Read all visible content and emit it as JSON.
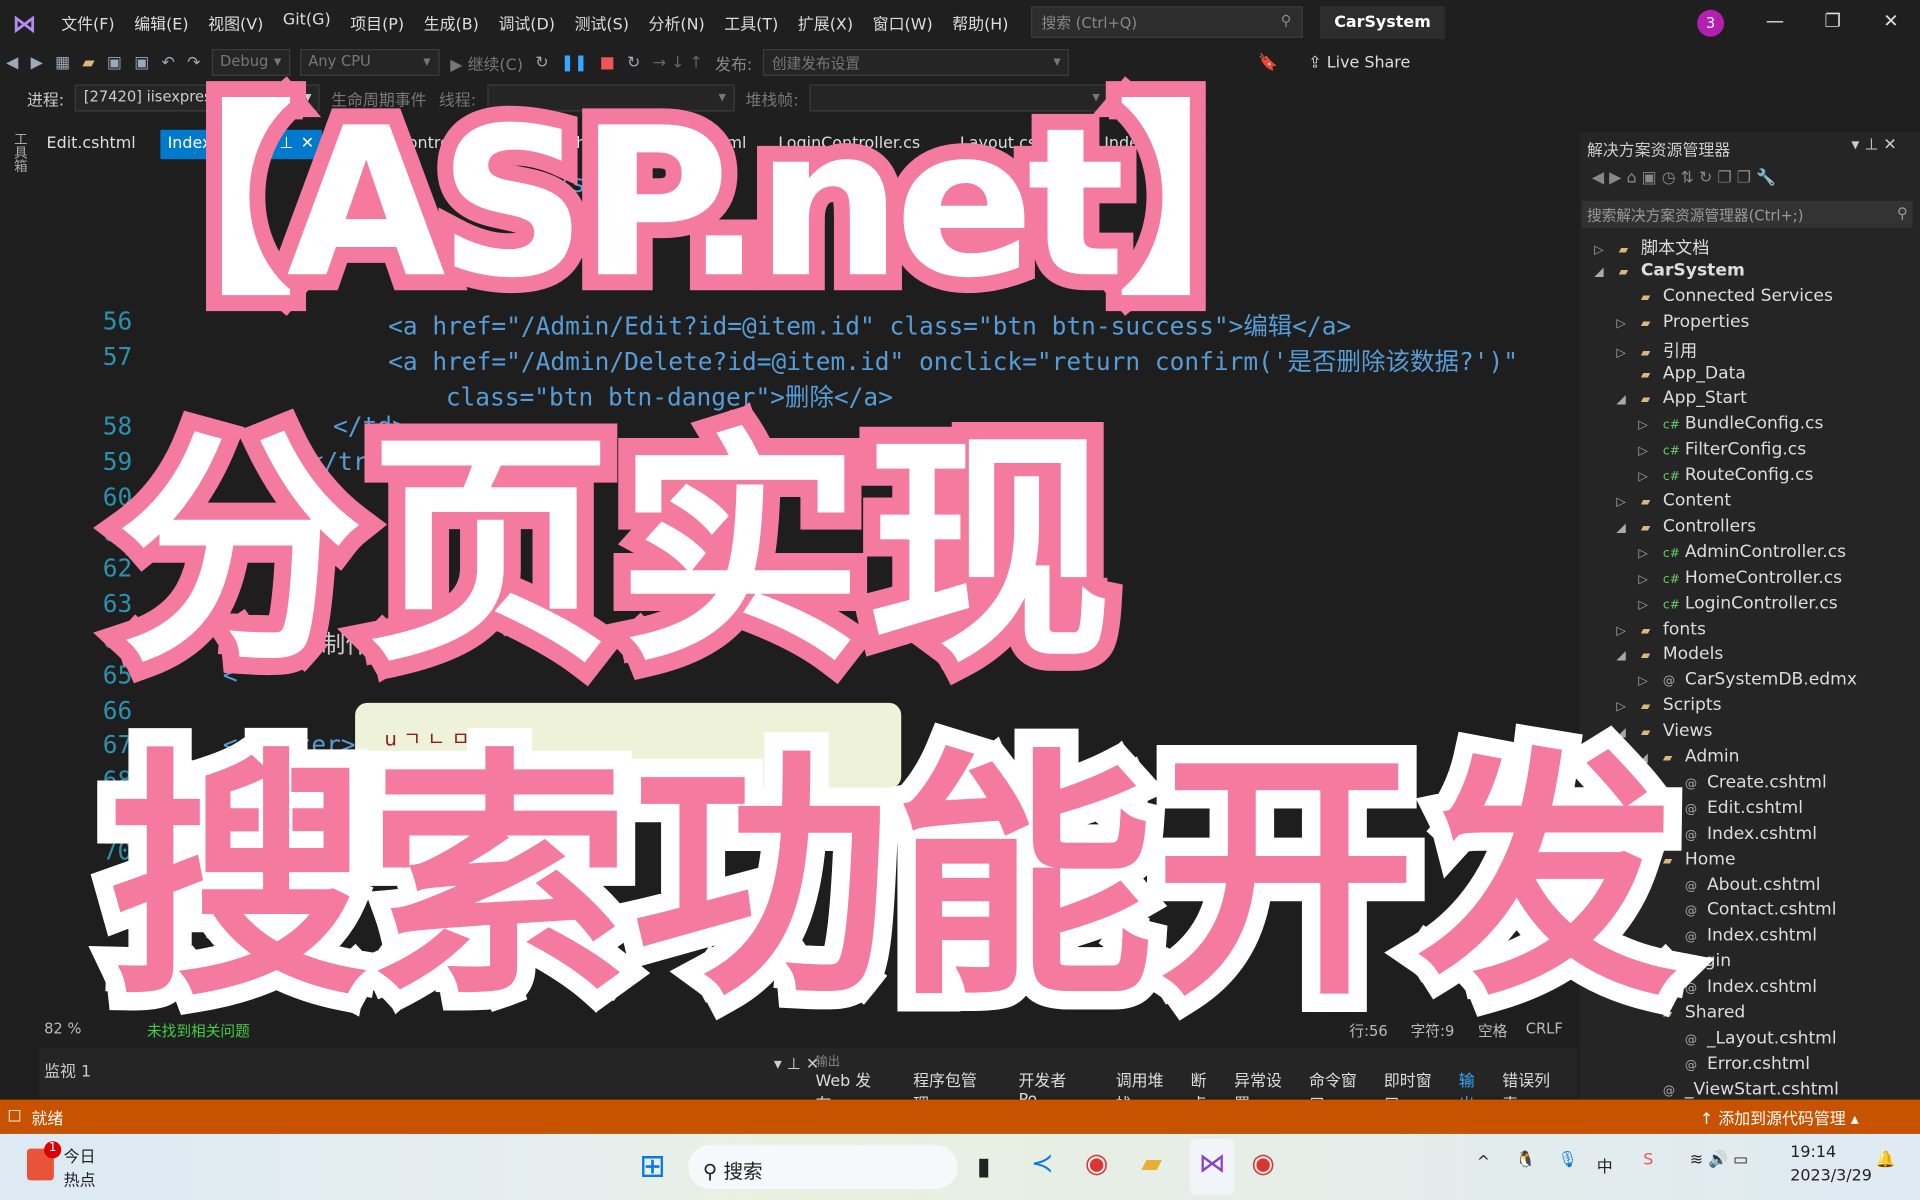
{
  "menubar": {
    "items": [
      "文件(F)",
      "编辑(E)",
      "视图(V)",
      "Git(G)",
      "项目(P)",
      "生成(B)",
      "调试(D)",
      "测试(S)",
      "分析(N)",
      "工具(T)",
      "扩展(X)",
      "窗口(W)",
      "帮助(H)"
    ],
    "search_placeholder": "搜索 (Ctrl+Q)",
    "solution": "CarSystem",
    "notifications": "3"
  },
  "toolbar": {
    "config": "Debug",
    "platform": "Any CPU",
    "continue": "继续(C)",
    "publish_label": "发布:",
    "publish_value": "创建发布设置",
    "live_share": "Live Share"
  },
  "toolbar2": {
    "process_label": "进程:",
    "process": "[27420] iisexpress.exe",
    "lifecycle": "生命周期事件",
    "thread_label": "线程:",
    "stack_label": "堆栈帧:"
  },
  "left_strip": "工具箱",
  "tabs": [
    {
      "label": "Edit.cshtml"
    },
    {
      "label": "Index.cshtml",
      "active": true
    },
    {
      "label": "AdminController.cs"
    },
    {
      "label": "index.html"
    },
    {
      "label": "Index.cshtml"
    },
    {
      "label": "LoginController.cs"
    },
    {
      "label": "_Layout.cshtml"
    },
    {
      "label": "Index.cshtml"
    }
  ],
  "code": {
    "lines": [
      {
        "n": "",
        "t": "员</span>"
      },
      {
        "n": "",
        "t": "</td>"
      },
      {
        "n": "56",
        "t": "<a href=\"/Admin/Edit?id=@item.id\" class=\"btn btn-success\">编辑</a>"
      },
      {
        "n": "57",
        "t": "<a href=\"/Admin/Delete?id=@item.id\" onclick=\"return confirm('是否删除该数据?')\""
      },
      {
        "n": "",
        "t": "  class=\"btn btn-danger\">删除</a>"
      },
      {
        "n": "58",
        "t": "</td>"
      },
      {
        "n": "59",
        "t": "</tr>"
      },
      {
        "n": "60",
        "t": ""
      },
      {
        "n": "61",
        "t": ""
      },
      {
        "n": "62",
        "t": ""
      },
      {
        "n": "63",
        "t": ""
      },
      {
        "n": "64",
        "t": "制作"
      },
      {
        "n": "65",
        "t": "<"
      },
      {
        "n": "66",
        "t": ""
      },
      {
        "n": "67",
        "t": "</center>"
      },
      {
        "n": "68",
        "t": ""
      },
      {
        "n": "69",
        "t": ""
      },
      {
        "n": "70",
        "t": ""
      },
      {
        "n": "71",
        "t": ""
      }
    ],
    "popup": "u  ㄱ ㄴ ㅁ ㅅ ㅈ"
  },
  "editor_status": {
    "zoom": "82 %",
    "issues": "未找到相关问题",
    "line": "行:56",
    "char": "字符:9",
    "spaces": "空格",
    "eol": "CRLF"
  },
  "bottom": {
    "watch": "监视 1",
    "output_label": "输出",
    "tabs": [
      "Web 发布...",
      "程序包管理...",
      "开发者 Po...",
      "调用堆栈",
      "断点",
      "异常设置",
      "命令窗口",
      "即时窗口",
      "输出",
      "错误列表"
    ]
  },
  "solution_explorer": {
    "title": "解决方案资源管理器",
    "search_placeholder": "搜索解决方案资源管理器(Ctrl+;)",
    "items": [
      {
        "l": "脚本文档",
        "d": 0,
        "e": "▷"
      },
      {
        "l": "CarSystem",
        "d": 0,
        "e": "◢",
        "b": true
      },
      {
        "l": "Connected Services",
        "d": 1,
        "e": ""
      },
      {
        "l": "Properties",
        "d": 1,
        "e": "▷"
      },
      {
        "l": "引用",
        "d": 1,
        "e": "▷"
      },
      {
        "l": "App_Data",
        "d": 1,
        "e": ""
      },
      {
        "l": "App_Start",
        "d": 1,
        "e": "◢"
      },
      {
        "l": "BundleConfig.cs",
        "d": 2,
        "e": "▷"
      },
      {
        "l": "FilterConfig.cs",
        "d": 2,
        "e": "▷"
      },
      {
        "l": "RouteConfig.cs",
        "d": 2,
        "e": "▷"
      },
      {
        "l": "Content",
        "d": 1,
        "e": "▷"
      },
      {
        "l": "Controllers",
        "d": 1,
        "e": "◢"
      },
      {
        "l": "AdminController.cs",
        "d": 2,
        "e": "▷"
      },
      {
        "l": "HomeController.cs",
        "d": 2,
        "e": "▷"
      },
      {
        "l": "LoginController.cs",
        "d": 2,
        "e": "▷"
      },
      {
        "l": "fonts",
        "d": 1,
        "e": "▷"
      },
      {
        "l": "Models",
        "d": 1,
        "e": "◢"
      },
      {
        "l": "CarSystemDB.edmx",
        "d": 2,
        "e": "▷"
      },
      {
        "l": "Scripts",
        "d": 1,
        "e": "▷"
      },
      {
        "l": "Views",
        "d": 1,
        "e": "◢"
      },
      {
        "l": "Admin",
        "d": 2,
        "e": "◢"
      },
      {
        "l": "Create.cshtml",
        "d": 3,
        "e": ""
      },
      {
        "l": "Edit.cshtml",
        "d": 3,
        "e": ""
      },
      {
        "l": "Index.cshtml",
        "d": 3,
        "e": ""
      },
      {
        "l": "Home",
        "d": 2,
        "e": ""
      },
      {
        "l": "About.cshtml",
        "d": 3,
        "e": ""
      },
      {
        "l": "Contact.cshtml",
        "d": 3,
        "e": ""
      },
      {
        "l": "Index.cshtml",
        "d": 3,
        "e": ""
      },
      {
        "l": "Login",
        "d": 2,
        "e": ""
      },
      {
        "l": "Index.cshtml",
        "d": 3,
        "e": ""
      },
      {
        "l": "Shared",
        "d": 2,
        "e": ""
      },
      {
        "l": "_Layout.cshtml",
        "d": 3,
        "e": ""
      },
      {
        "l": "Error.cshtml",
        "d": 3,
        "e": ""
      },
      {
        "l": "_ViewStart.cshtml",
        "d": 2,
        "e": ""
      }
    ]
  },
  "statusbar": {
    "ready": "就绪",
    "source_control": "添加到源代码管理",
    "color": "#c75300"
  },
  "taskbar": {
    "news_title": "今日",
    "news_sub": "热点",
    "news_badge": "1",
    "search": "搜索",
    "ime": "中",
    "time": "19:14",
    "date": "2023/3/29"
  },
  "overlay": {
    "line1": "【ASP.net】",
    "line2": "分页实现",
    "line3": "搜索功能开发",
    "pink": "#f47aa0"
  }
}
